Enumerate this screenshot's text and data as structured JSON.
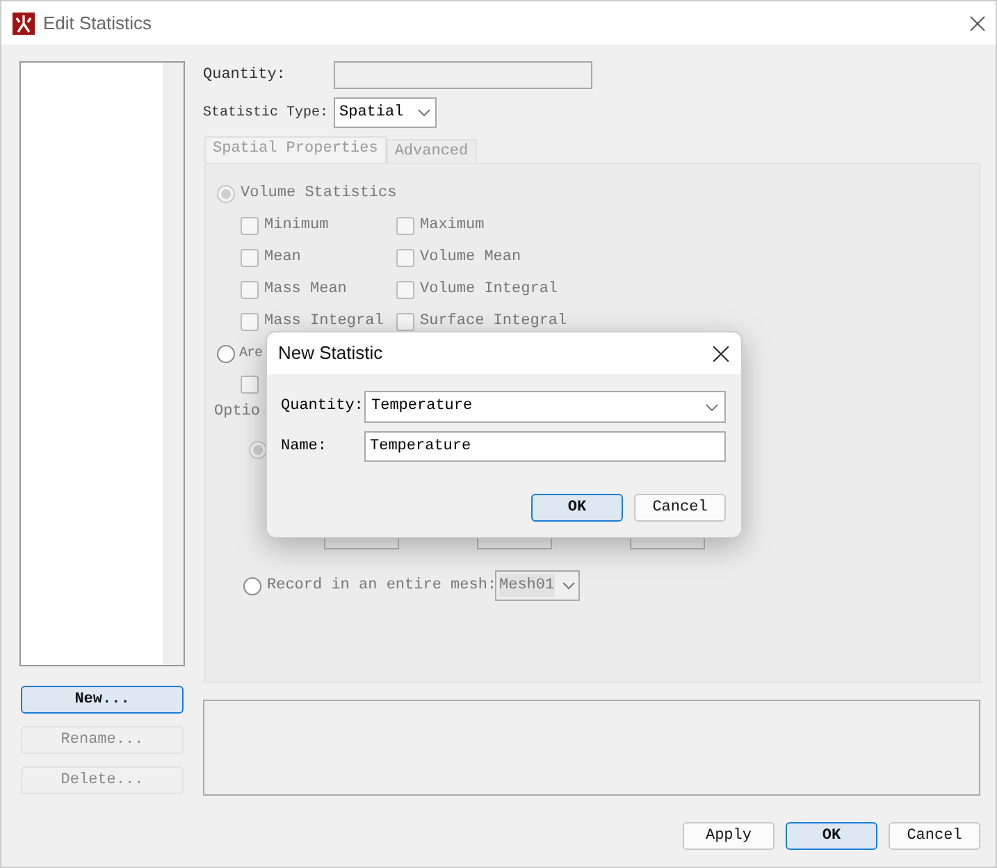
{
  "window": {
    "title": "Edit Statistics"
  },
  "list_buttons": [
    {
      "label": "New...",
      "focused": true,
      "disabled": false
    },
    {
      "label": "Rename...",
      "focused": false,
      "disabled": true
    },
    {
      "label": "Delete...",
      "focused": false,
      "disabled": true
    }
  ],
  "quantity": {
    "label": "Quantity:"
  },
  "statistic_type": {
    "label": "Statistic Type:",
    "value": "Spatial"
  },
  "tabs": [
    {
      "label": "Spatial Properties",
      "selected": true
    },
    {
      "label": "Advanced",
      "selected": false
    }
  ],
  "volume_statistics": {
    "label": "Volume Statistics",
    "selected": true,
    "disabled": true,
    "options": [
      {
        "label": "Minimum",
        "checked": false
      },
      {
        "label": "Maximum",
        "checked": false
      },
      {
        "label": "Mean",
        "checked": false
      },
      {
        "label": "Volume Mean",
        "checked": false
      },
      {
        "label": "Mass Mean",
        "checked": false
      },
      {
        "label": "Volume Integral",
        "checked": false
      },
      {
        "label": "Mass Integral",
        "checked": false
      },
      {
        "label": "Surface Integral",
        "checked": false
      }
    ]
  },
  "area_statistics": {
    "label": "Are",
    "selected": false,
    "option_checked": false
  },
  "options_group": {
    "label": "Optio",
    "first_selected": true,
    "record_mesh": {
      "label": "Record in an entire mesh:",
      "selected": false,
      "disabled": true,
      "value": "Mesh01"
    }
  },
  "footer_buttons": [
    {
      "label": "Apply",
      "focused": false
    },
    {
      "label": "OK",
      "focused": true
    },
    {
      "label": "Cancel",
      "focused": false
    }
  ],
  "dialog": {
    "title": "New Statistic",
    "quantity": {
      "label": "Quantity:",
      "value": "Temperature"
    },
    "name": {
      "label": "Name:",
      "value": "Temperature"
    },
    "buttons": [
      {
        "label": "OK",
        "focused": true
      },
      {
        "label": "Cancel",
        "focused": false
      }
    ]
  }
}
